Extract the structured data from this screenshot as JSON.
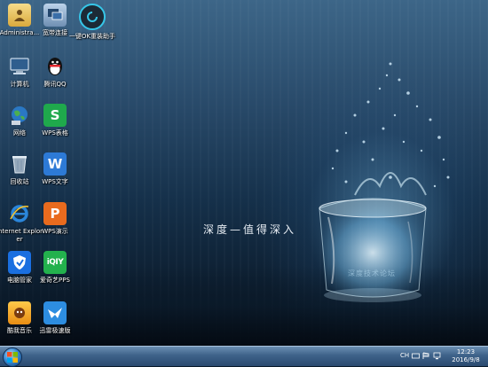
{
  "desktop": {
    "slogan": "深度—值得深入",
    "watermark": "深度技术论坛",
    "icons": [
      {
        "label": "Administra...",
        "icon": "folder-user-icon",
        "color": "#e7c15a"
      },
      {
        "label": "宽带连接",
        "icon": "broadband-connection-icon",
        "color": "#7d9bbd"
      },
      {
        "label": "一键OK重装助手",
        "icon": "reinstall-assistant-icon",
        "color": "#1c2a36"
      },
      {
        "label": "计算机",
        "icon": "computer-icon",
        "color": "#6a8cb0"
      },
      {
        "label": "腾讯QQ",
        "icon": "qq-penguin-icon",
        "color": "#111111"
      },
      {
        "label": "网络",
        "icon": "network-globe-icon",
        "color": "#3d8bd0"
      },
      {
        "label": "WPS表格",
        "icon": "wps-spreadsheet-icon",
        "color": "#1fa94c"
      },
      {
        "label": "回收站",
        "icon": "recycle-bin-icon",
        "color": "#8fa4b8"
      },
      {
        "label": "WPS文字",
        "icon": "wps-writer-icon",
        "color": "#2d7ad6"
      },
      {
        "label": "Internet Explorer",
        "icon": "internet-explorer-icon",
        "color": "#1d73c9"
      },
      {
        "label": "WPS演示",
        "icon": "wps-presentation-icon",
        "color": "#e96b1e"
      },
      {
        "label": "电脑管家",
        "icon": "pc-manager-shield-icon",
        "color": "#1a6fe0"
      },
      {
        "label": "爱奇艺PPS",
        "icon": "iqiyi-pps-icon",
        "color": "#23b14d"
      },
      {
        "label": "酷我音乐",
        "icon": "kuwo-music-icon",
        "color": "#f0a020"
      },
      {
        "label": "迅雷极速版",
        "icon": "xunlei-bird-icon",
        "color": "#2d8de0"
      }
    ]
  },
  "taskbar": {
    "start_icon": "windows-start-orb-icon",
    "language": "CH",
    "time": "12:23",
    "date": "2016/9/8"
  }
}
